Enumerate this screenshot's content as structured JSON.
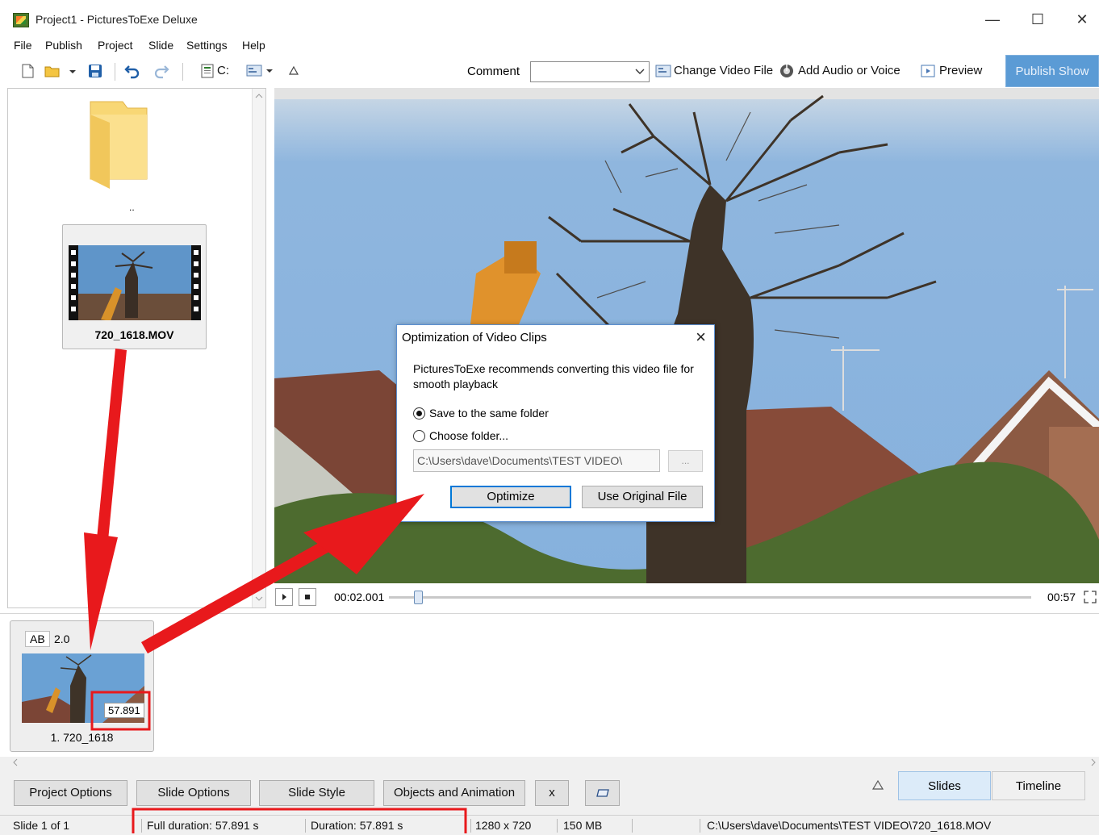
{
  "window": {
    "title": "Project1 - PicturesToExe Deluxe",
    "controls": {
      "minimize": "—",
      "maximize": "☐",
      "close": "✕"
    }
  },
  "menu": [
    "File",
    "Publish",
    "Project",
    "Slide",
    "Settings",
    "Help"
  ],
  "toolbar": {
    "drive": "C:",
    "comment_label": "Comment",
    "comment_value": "",
    "change_video": "Change Video File",
    "add_audio": "Add Audio or Voice",
    "preview": "Preview",
    "publish": "Publish Show"
  },
  "file_panel": {
    "parent_folder": "..",
    "file_name": "720_1618.MOV"
  },
  "playbar": {
    "current_time": "00:02.001",
    "total_time": "00:57",
    "progress": 0.04
  },
  "slide": {
    "transition": "AB",
    "transition_duration": "2.0",
    "duration_badge": "57.891",
    "caption": "1. 720_1618"
  },
  "bottom_buttons": {
    "project_options": "Project Options",
    "slide_options": "Slide Options",
    "slide_style": "Slide Style",
    "objects_animation": "Objects and Animation",
    "x_button": "x",
    "slides_tab": "Slides",
    "timeline_tab": "Timeline"
  },
  "status": {
    "slide": "Slide 1 of 1",
    "full_duration": "Full duration: 57.891 s",
    "duration": "Duration: 57.891 s",
    "resolution": "1280 x 720",
    "size": "150 MB",
    "path": "C:\\Users\\dave\\Documents\\TEST VIDEO\\720_1618.MOV"
  },
  "dialog": {
    "title": "Optimization of Video Clips",
    "message": "PicturesToExe recommends converting this video file for smooth playback",
    "option_same": "Save to the same folder",
    "option_choose": "Choose folder...",
    "folder_path": "C:\\Users\\dave\\Documents\\TEST VIDEO\\",
    "browse": "...",
    "optimize": "Optimize",
    "use_original": "Use Original File"
  },
  "colors": {
    "accent": "#5b9bd5",
    "annotation_red": "#e8191c"
  }
}
